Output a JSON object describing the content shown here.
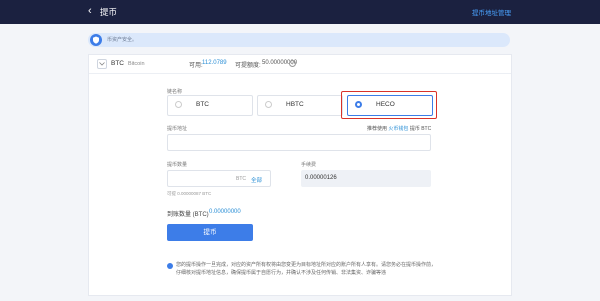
{
  "header": {
    "back_glyph": "‹",
    "title": "提币",
    "address_mgmt_link": "提币地址管理"
  },
  "notice": {
    "text": "币资产安全。"
  },
  "coin": {
    "symbol": "BTC",
    "name": "Bitcoin",
    "available_label": "可用:",
    "available_value": "112.0789",
    "quota_label": "可提额度:",
    "quota_value": "50.00000000",
    "quota_info_glyph": "?"
  },
  "chain": {
    "label": "链名称",
    "options": [
      {
        "label": "BTC",
        "selected": false
      },
      {
        "label": "HBTC",
        "selected": false
      },
      {
        "label": "HECO",
        "selected": true
      }
    ]
  },
  "address": {
    "label": "提币地址",
    "recommend_prefix": "推荐使用",
    "recommend_link": "火币钱包",
    "recommend_suffix": "提币 BTC",
    "value": "",
    "placeholder": ""
  },
  "amount": {
    "label": "提币数量",
    "unit": "BTC",
    "all_label": "全部",
    "value": "",
    "hint": "可提 0.00000087 BTC"
  },
  "fee": {
    "label": "手续费",
    "value": "0.00000126"
  },
  "received": {
    "label": "到账数量 (BTC)",
    "value": "0.00000000"
  },
  "submit": {
    "label": "提币"
  },
  "warning": {
    "text": "您的提币操作一旦完成，对应的资产所有权将由您变更为目标地址所对应的账户所有人享有。请您务必在提币操作前，仔细核对提币地址信息，确保提币属于自愿行为，并确认不涉及任何传销、非法集资、诈骗等违"
  },
  "colors": {
    "accent": "#3d7de8",
    "link": "#2b8fd6",
    "highlight": "#d9322a",
    "topbar": "#1b2140"
  }
}
